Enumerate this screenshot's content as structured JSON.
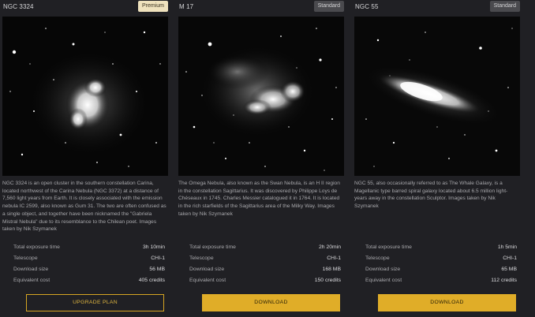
{
  "cards": [
    {
      "title": "NGC 3324",
      "badge": "Premium",
      "description": "NGC 3324 is an open cluster in the southern constellation Carina, located northwest of the Carina Nebula (NGC 3372) at a distance of 7,560 light years from Earth. It is closely associated with the emission nebula IC 2599, also known as Gum 31. The two are often confused as a single object, and together have been nicknamed the \"Gabriela Mistral Nebula\" due to its resemblance to the Chilean poet. Images taken by Nik Szymanek",
      "stats": [
        {
          "label": "Total exposure time",
          "value": "3h 10min"
        },
        {
          "label": "Telescope",
          "value": "CHI-1"
        },
        {
          "label": "Download size",
          "value": "56 MB"
        },
        {
          "label": "Equivalent cost",
          "value": "405 credits"
        }
      ],
      "button": "UPGRADE PLAN"
    },
    {
      "title": "M 17",
      "badge": "Standard",
      "description": "The Omega Nebula, also known as the Swan Nebula, is an H II region in the constellation Sagittarius. It was discovered by Philippe Loys de Chéseaux in 1745. Charles Messier catalogued it in 1764. It is located in the rich starfields of the Sagittarius area of the Milky Way. Images taken by Nik Szymanek",
      "stats": [
        {
          "label": "Total exposure time",
          "value": "2h 20min"
        },
        {
          "label": "Telescope",
          "value": "CHI-1"
        },
        {
          "label": "Download size",
          "value": "168 MB"
        },
        {
          "label": "Equivalent cost",
          "value": "150 credits"
        }
      ],
      "button": "DOWNLOAD"
    },
    {
      "title": "NGC 55",
      "badge": "Standard",
      "description": "NGC 55, also occasionally referred to as The Whale Galaxy, is a Magellanic type barred spiral galaxy located about 6.5 million light-years away in the constellation Sculptor. Images taken by Nik Szymanek",
      "stats": [
        {
          "label": "Total exposure time",
          "value": "1h 5min"
        },
        {
          "label": "Telescope",
          "value": "CHI-1"
        },
        {
          "label": "Download size",
          "value": "65 MB"
        },
        {
          "label": "Equivalent cost",
          "value": "112 credits"
        }
      ],
      "button": "DOWNLOAD"
    }
  ],
  "colors": {
    "background": "#202024",
    "accent": "#e0ad28",
    "premium_badge": "#efe2bd",
    "standard_badge": "#4a4a4e"
  }
}
